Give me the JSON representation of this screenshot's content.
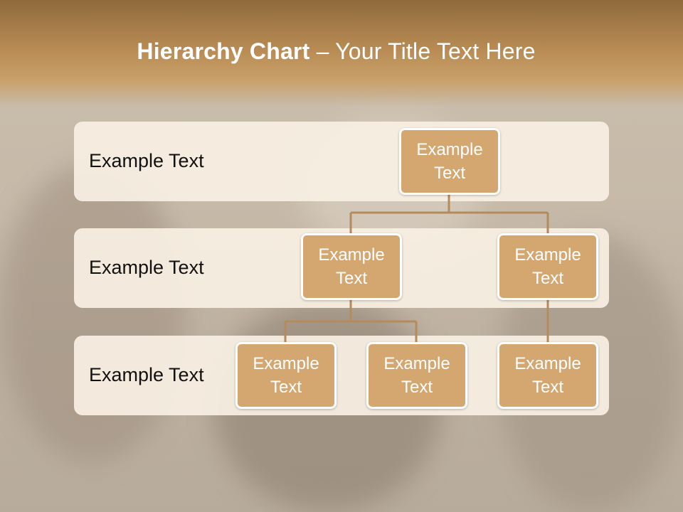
{
  "title": {
    "bold": "Hierarchy Chart",
    "rest": " – Your Title Text Here"
  },
  "levels": [
    {
      "label": "Example Text"
    },
    {
      "label": "Example Text"
    },
    {
      "label": "Example Text"
    }
  ],
  "nodes": {
    "root": "Example Text",
    "level2_left": "Example Text",
    "level2_right": "Example Text",
    "level3_a": "Example Text",
    "level3_b": "Example Text",
    "level3_c": "Example Text"
  },
  "colors": {
    "node_fill": "#d4a771",
    "connector": "#b48b5c",
    "header": "#b78a52",
    "band": "#f8f0e4"
  }
}
